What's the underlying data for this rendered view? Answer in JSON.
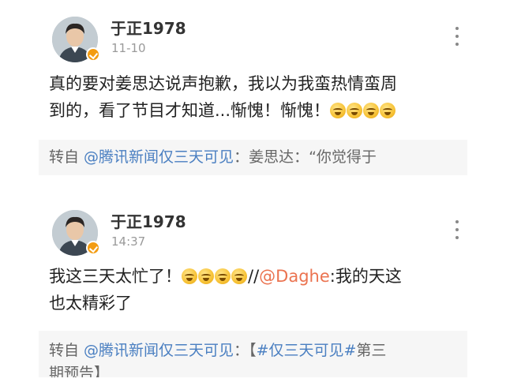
{
  "posts": [
    {
      "username": "于正1978",
      "time": "11-10",
      "text_line1": "真的要对姜思达说声抱歉，我以为我蛮热情蛮周",
      "text_line2": "到的，看了节目才知道...惭愧！惭愧！",
      "emoji_count": 4,
      "emoji_icon": "crying-laughing-emoji",
      "repost_prefix": "转自 ",
      "repost_link": "@腾讯新闻仅三天可见",
      "repost_rest": "：姜思达：“你觉得于"
    },
    {
      "username": "于正1978",
      "time": "14:37",
      "text_line1_start": "我这三天太忙了！",
      "emoji_count": 4,
      "emoji_icon": "crying-laughing-emoji",
      "text_line1_sep": "//",
      "mention": "@Daghe",
      "text_line1_end": ":我的天这",
      "text_line2": "也太精彩了",
      "repost_prefix": "转自 ",
      "repost_link": "@腾讯新闻仅三天可见",
      "repost_rest": "：【",
      "repost_topic": "#仅三天可见#",
      "repost_rest2": "第三",
      "repost_line2": "期预告】"
    }
  ],
  "colors": {
    "link": "#4a7fc1",
    "mention": "#eb7350",
    "repost_bg": "#f6f6f6",
    "verified_badge": "#f39c12"
  },
  "icons": [
    "avatar",
    "verified-badge-icon",
    "more-options-icon",
    "crying-laughing-emoji"
  ]
}
